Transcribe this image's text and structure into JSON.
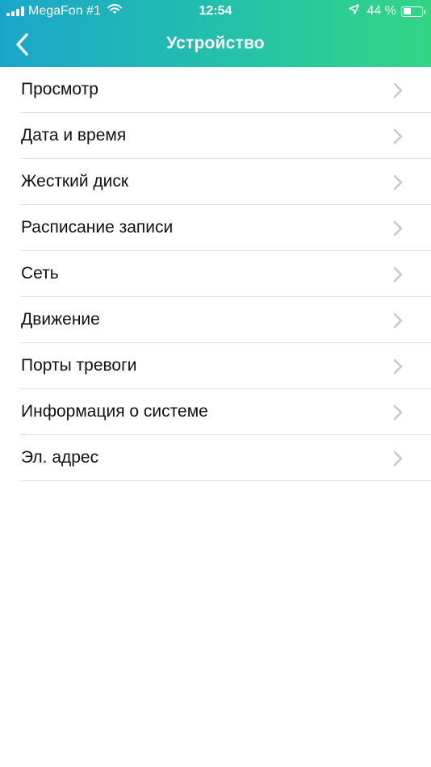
{
  "status_bar": {
    "carrier": "MegaFon #1",
    "time": "12:54",
    "battery_percent": "44 %",
    "battery_level": 0.44,
    "icons": [
      "signal-icon",
      "wifi-icon",
      "location-arrow-icon",
      "battery-icon"
    ]
  },
  "nav": {
    "title": "Устройство",
    "back_icon": "chevron-left-icon"
  },
  "menu": {
    "items": [
      {
        "label": "Просмотр"
      },
      {
        "label": "Дата и время"
      },
      {
        "label": "Жесткий диск"
      },
      {
        "label": "Расписание записи"
      },
      {
        "label": "Сеть"
      },
      {
        "label": "Движение"
      },
      {
        "label": "Порты тревоги"
      },
      {
        "label": "Информация о системе"
      },
      {
        "label": "Эл. адрес"
      }
    ],
    "item_icon": "chevron-right-icon"
  },
  "colors": {
    "header_gradient_start": "#1aa6cc",
    "header_gradient_end": "#33d585",
    "chevron": "#c7c7cc",
    "separator": "#dcdcdc"
  }
}
